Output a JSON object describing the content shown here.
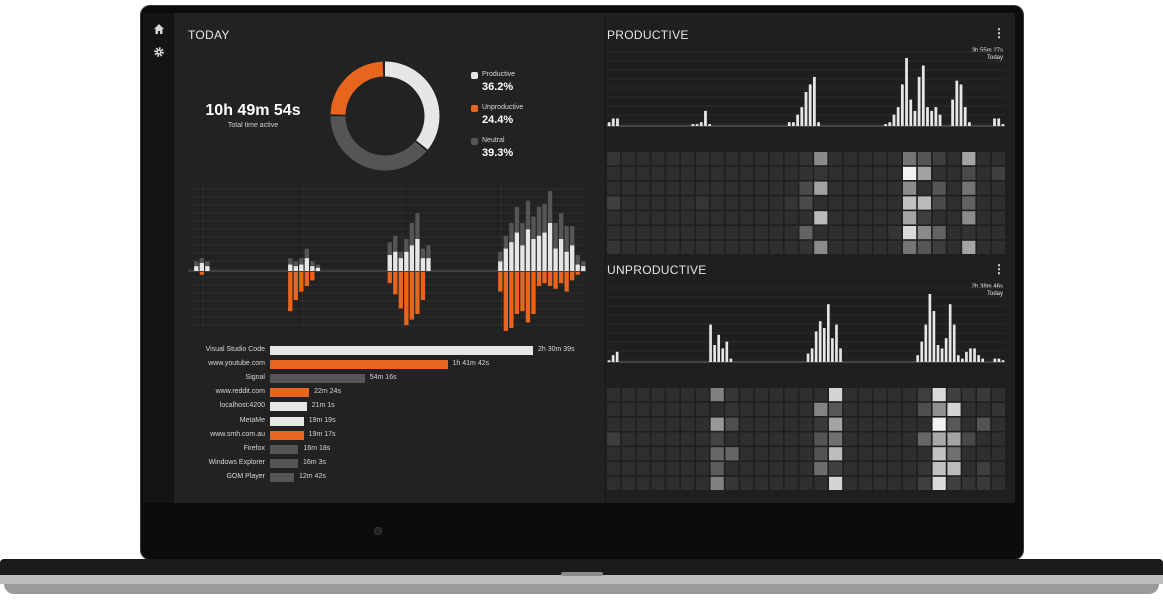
{
  "today": {
    "title": "TODAY",
    "total_time": "10h 49m 54s",
    "total_label": "Total time active",
    "breakdown": [
      {
        "label": "Productive",
        "value": "36.2%",
        "fraction": 0.362,
        "color": "#e6e6e6"
      },
      {
        "label": "Unproductive",
        "value": "24.4%",
        "fraction": 0.244,
        "color": "#e8651e"
      },
      {
        "label": "Neutral",
        "value": "39.3%",
        "fraction": 0.393,
        "color": "#555555"
      }
    ],
    "apps": [
      {
        "name": "Visual Studio Code",
        "duration": "2h 30m 39s",
        "minutes": 150.65,
        "kind": "productive"
      },
      {
        "name": "www.youtube.com",
        "duration": "1h 41m 42s",
        "minutes": 101.7,
        "kind": "unproductive"
      },
      {
        "name": "Signal",
        "duration": "54m 16s",
        "minutes": 54.27,
        "kind": "neutral"
      },
      {
        "name": "www.reddit.com",
        "duration": "22m 24s",
        "minutes": 22.4,
        "kind": "unproductive"
      },
      {
        "name": "localhost:4200",
        "duration": "21m 1s",
        "minutes": 21.02,
        "kind": "productive"
      },
      {
        "name": "MetaMe",
        "duration": "19m 19s",
        "minutes": 19.32,
        "kind": "productive"
      },
      {
        "name": "www.smh.com.au",
        "duration": "19m 17s",
        "minutes": 19.28,
        "kind": "unproductive"
      },
      {
        "name": "Firefox",
        "duration": "16m 18s",
        "minutes": 16.3,
        "kind": "neutral"
      },
      {
        "name": "Windows Explorer",
        "duration": "16m 3s",
        "minutes": 16.05,
        "kind": "neutral"
      },
      {
        "name": "GOM Player",
        "duration": "12m 42s",
        "minutes": 12.7,
        "kind": "neutral"
      }
    ],
    "timeline": {
      "neutral": [
        0,
        6,
        8,
        6,
        0,
        0,
        0,
        0,
        0,
        0,
        0,
        0,
        0,
        0,
        0,
        0,
        0,
        0,
        8,
        6,
        8,
        14,
        6,
        4,
        0,
        0,
        0,
        0,
        0,
        0,
        0,
        0,
        0,
        0,
        0,
        0,
        18,
        22,
        12,
        20,
        30,
        36,
        14,
        16,
        0,
        0,
        0,
        0,
        0,
        0,
        0,
        0,
        0,
        0,
        0,
        0,
        12,
        22,
        30,
        40,
        30,
        44,
        34,
        40,
        42,
        50,
        30,
        36,
        28,
        28,
        10,
        6
      ],
      "productive": [
        0,
        3,
        5,
        3,
        0,
        0,
        0,
        0,
        0,
        0,
        0,
        0,
        0,
        0,
        0,
        0,
        0,
        0,
        4,
        3,
        4,
        8,
        3,
        2,
        0,
        0,
        0,
        0,
        0,
        0,
        0,
        0,
        0,
        0,
        0,
        0,
        10,
        12,
        8,
        12,
        16,
        20,
        8,
        8,
        0,
        0,
        0,
        0,
        0,
        0,
        0,
        0,
        0,
        0,
        0,
        0,
        6,
        14,
        18,
        24,
        16,
        26,
        20,
        22,
        24,
        30,
        14,
        20,
        12,
        16,
        4,
        3
      ],
      "unproductive": [
        0,
        0,
        2,
        0,
        0,
        0,
        0,
        0,
        0,
        0,
        0,
        0,
        0,
        0,
        0,
        0,
        0,
        0,
        28,
        20,
        14,
        10,
        6,
        0,
        0,
        0,
        0,
        0,
        0,
        0,
        0,
        0,
        0,
        0,
        0,
        0,
        8,
        16,
        26,
        38,
        34,
        30,
        20,
        0,
        0,
        0,
        0,
        0,
        0,
        0,
        0,
        0,
        0,
        0,
        0,
        0,
        14,
        44,
        40,
        30,
        28,
        36,
        30,
        10,
        8,
        10,
        12,
        8,
        14,
        6,
        2,
        0
      ]
    }
  },
  "productive": {
    "title": "PRODUCTIVE",
    "corner_time": "3h 55m 27s",
    "corner_label": "Today",
    "bars": [
      2,
      4,
      4,
      0,
      0,
      0,
      0,
      0,
      0,
      0,
      0,
      0,
      0,
      0,
      0,
      0,
      0,
      0,
      0,
      0,
      1,
      1,
      2,
      8,
      1,
      0,
      0,
      0,
      0,
      0,
      0,
      0,
      0,
      0,
      0,
      0,
      0,
      0,
      0,
      0,
      0,
      0,
      0,
      2,
      2,
      6,
      10,
      18,
      22,
      26,
      2,
      0,
      0,
      0,
      0,
      0,
      0,
      0,
      0,
      0,
      0,
      0,
      0,
      0,
      0,
      0,
      1,
      2,
      6,
      10,
      22,
      36,
      14,
      8,
      26,
      32,
      10,
      8,
      10,
      6,
      0,
      0,
      14,
      24,
      22,
      10,
      2,
      0,
      0,
      0,
      0,
      0,
      4,
      4,
      1
    ]
  },
  "unproductive": {
    "title": "UNPRODUCTIVE",
    "corner_time": "2h 38m 46s",
    "corner_label": "Today",
    "bars": [
      1,
      4,
      6,
      0,
      0,
      0,
      0,
      0,
      0,
      0,
      0,
      0,
      0,
      0,
      0,
      0,
      0,
      0,
      0,
      0,
      0,
      0,
      0,
      0,
      0,
      22,
      10,
      16,
      8,
      12,
      2,
      0,
      0,
      0,
      0,
      0,
      0,
      0,
      0,
      0,
      0,
      0,
      0,
      0,
      0,
      0,
      0,
      0,
      0,
      5,
      8,
      18,
      24,
      20,
      34,
      14,
      22,
      8,
      0,
      0,
      0,
      0,
      0,
      0,
      0,
      0,
      0,
      0,
      0,
      0,
      0,
      0,
      0,
      0,
      0,
      0,
      4,
      12,
      22,
      40,
      30,
      10,
      8,
      14,
      34,
      22,
      4,
      2,
      6,
      8,
      8,
      4,
      2,
      0,
      0,
      2,
      2,
      1
    ]
  },
  "menu_icon": "vertical-dots-icon",
  "sidebar": {
    "icons": [
      "home-icon",
      "gear-icon"
    ]
  },
  "colors": {
    "productive": "#e6e6e6",
    "unproductive": "#e8651e",
    "neutral": "#555555",
    "background": "#222222"
  }
}
